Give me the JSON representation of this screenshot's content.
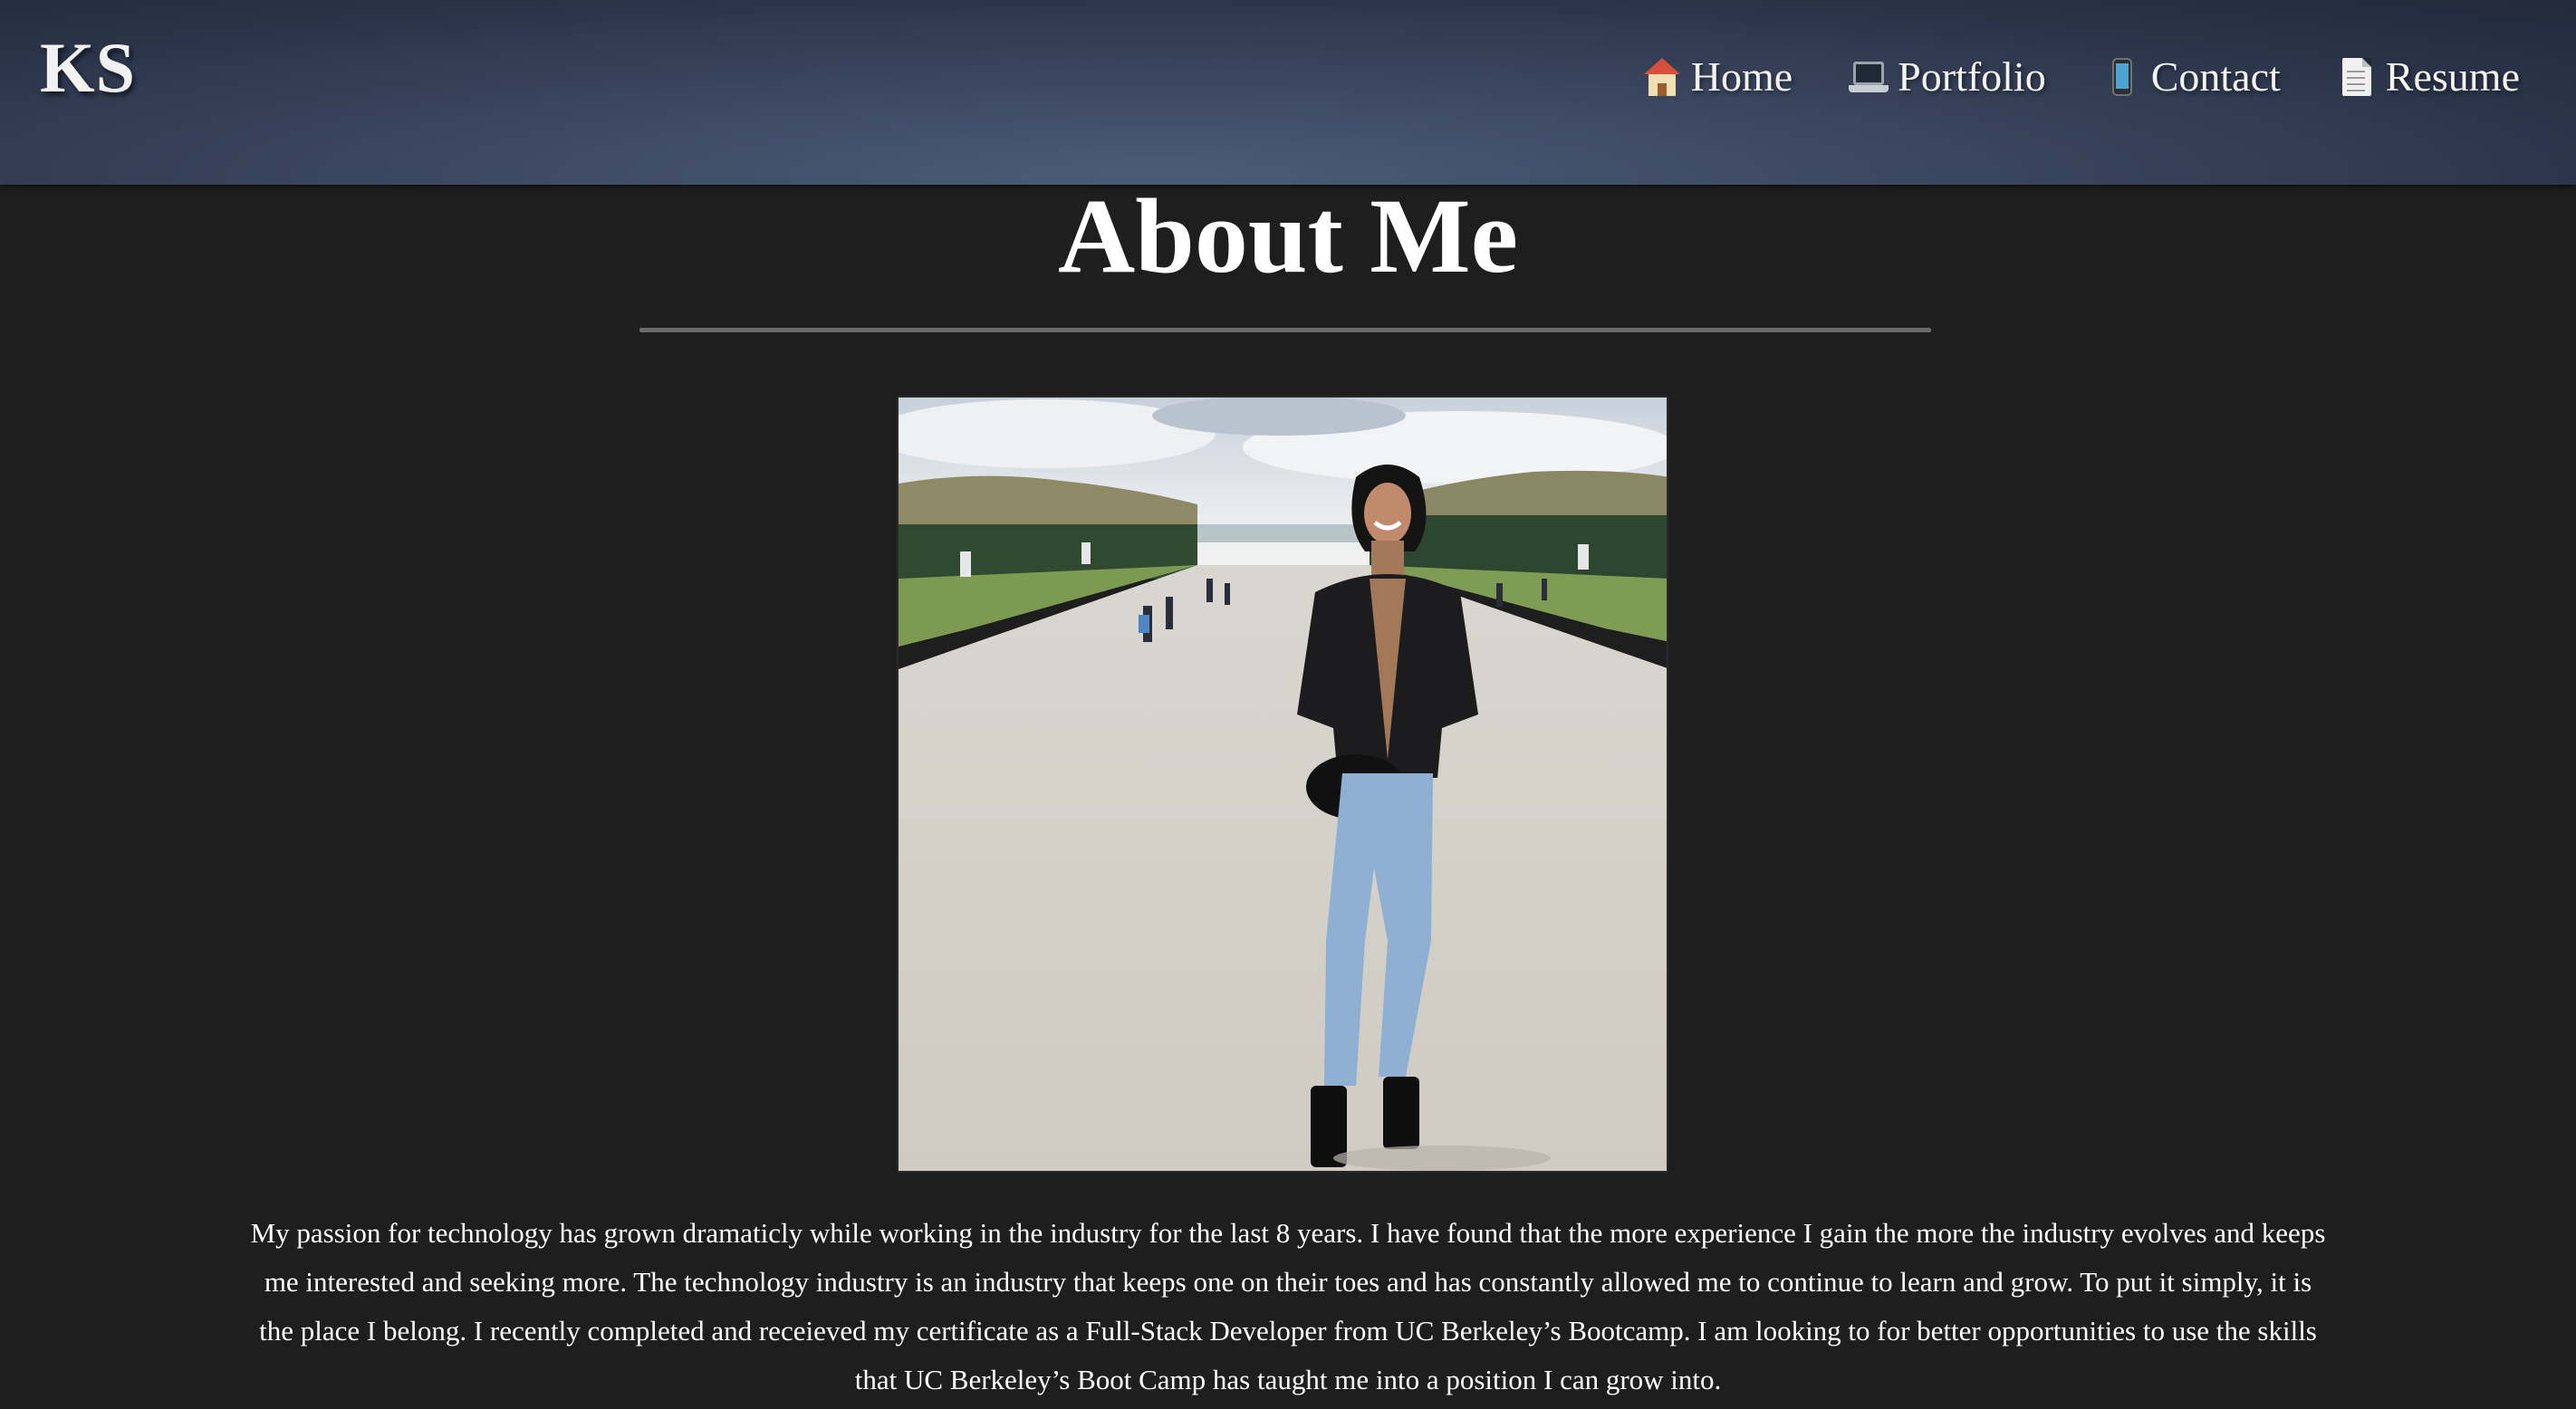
{
  "header": {
    "logo": "KS",
    "nav": [
      {
        "label": "Home",
        "icon": "house-icon"
      },
      {
        "label": "Portfolio",
        "icon": "laptop-icon"
      },
      {
        "label": "Contact",
        "icon": "mobile-phone-icon"
      },
      {
        "label": "Resume",
        "icon": "document-icon"
      }
    ]
  },
  "main": {
    "title": "About Me",
    "photo_alt": "Portrait photo in a formal garden",
    "bio": "My passion for technology has grown dramaticly while working in the industry for the last 8 years. I have found that the more experience I gain the more the industry evolves and keeps me interested and seeking more. The technology industry is an industry that keeps one on their toes and has constantly allowed me to continue to learn and grow. To put it simply, it is the place I belong. I recently completed and receieved my certificate as a Full-Stack Developer from UC Berkeley’s Bootcamp. I am looking to for better opportunities to use the skills that UC Berkeley’s Boot Camp has taught me into a position I can grow into."
  },
  "colors": {
    "page_background": "#1e1e1e",
    "header_background": "#3d4962",
    "divider": "#6c6c6c",
    "text": "#ffffff"
  }
}
